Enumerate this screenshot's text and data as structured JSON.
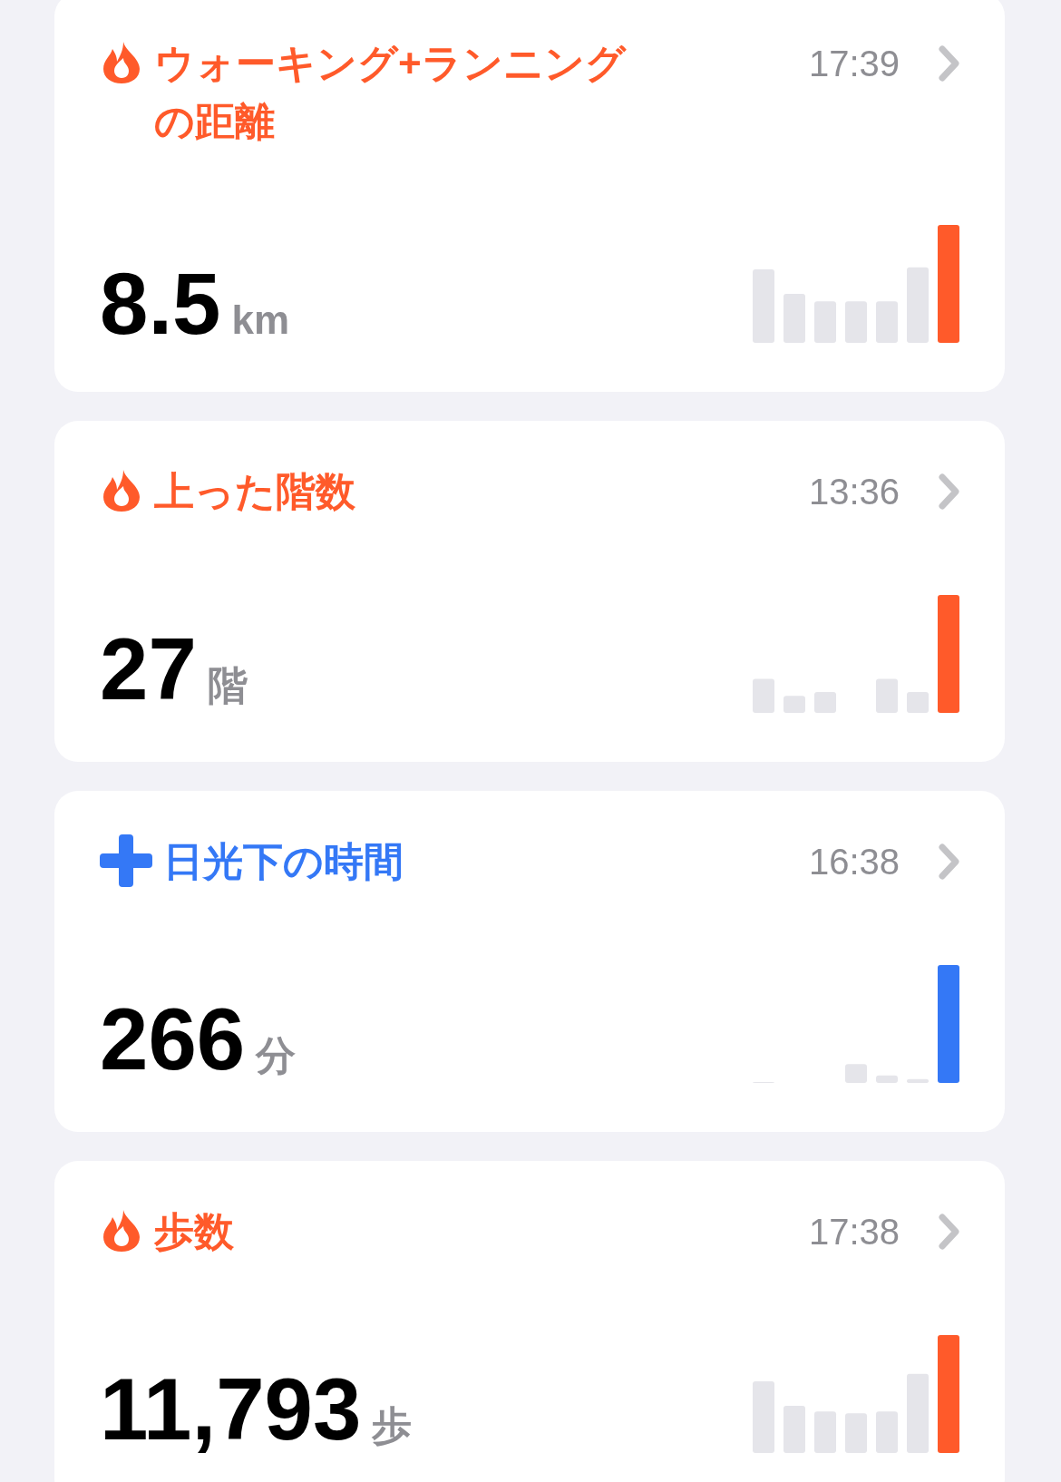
{
  "cards": [
    {
      "kind": "activity",
      "color": "#ff5a2a",
      "title": "ウォーキング+ランニングの距離",
      "time": "17:39",
      "value": "8.5",
      "unit": "km"
    },
    {
      "kind": "activity",
      "color": "#ff5a2a",
      "title": "上った階数",
      "time": "13:36",
      "value": "27",
      "unit": "階"
    },
    {
      "kind": "health",
      "color": "#3478f6",
      "title": "日光下の時間",
      "time": "16:38",
      "value": "266",
      "unit": "分"
    },
    {
      "kind": "activity",
      "color": "#ff5a2a",
      "title": "歩数",
      "time": "17:38",
      "value": "11,793",
      "unit": "歩"
    }
  ]
}
